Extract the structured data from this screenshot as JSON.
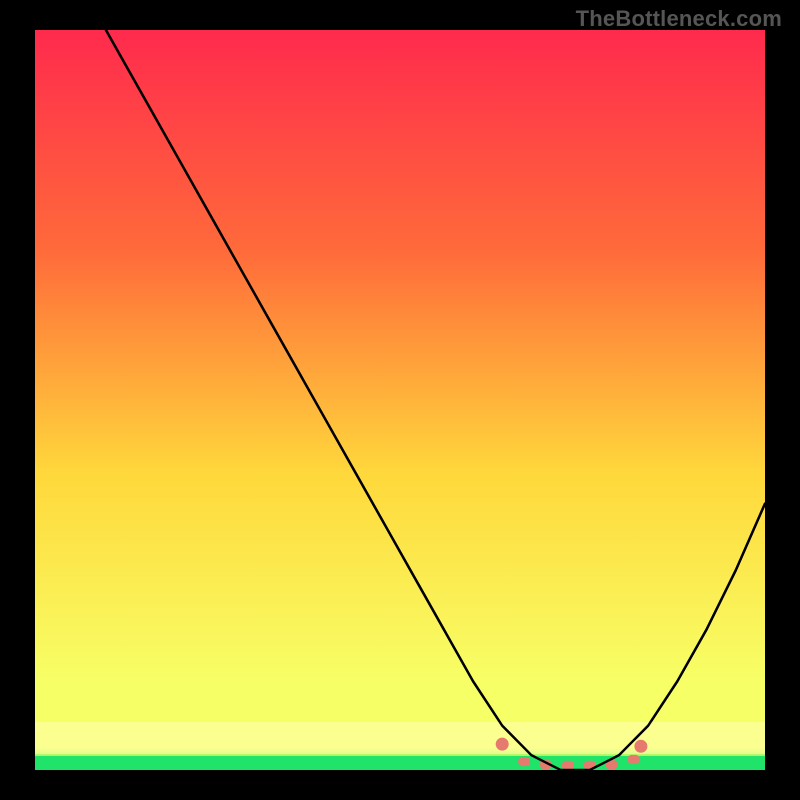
{
  "watermark": "TheBottleneck.com",
  "colors": {
    "bg": "#000000",
    "grad_top": "#ff2a4d",
    "grad_upper": "#ff6b3a",
    "grad_mid": "#ffd83b",
    "grad_low": "#f7ff66",
    "grad_bottom": "#20e36a",
    "curve": "#000000",
    "marker_fill": "#e77a6f",
    "marker_stroke": "#e77a6f"
  },
  "chart_data": {
    "type": "line",
    "title": "",
    "xlabel": "",
    "ylabel": "",
    "xlim": [
      0,
      100
    ],
    "ylim": [
      0,
      100
    ],
    "x": [
      0,
      4,
      8,
      12,
      16,
      20,
      24,
      28,
      32,
      36,
      40,
      44,
      48,
      52,
      56,
      60,
      64,
      68,
      72,
      76,
      80,
      84,
      88,
      92,
      96,
      100
    ],
    "values": [
      120,
      110,
      103,
      96,
      89,
      82,
      75,
      68,
      61,
      54,
      47,
      40,
      33,
      26,
      19,
      12,
      6,
      2,
      0,
      0,
      2,
      6,
      12,
      19,
      27,
      36
    ],
    "markers": {
      "x": [
        64,
        67,
        70,
        73,
        76,
        79,
        82,
        83
      ],
      "y": [
        3.5,
        1.2,
        0.8,
        0.7,
        0.7,
        0.8,
        1.5,
        3.2
      ]
    }
  }
}
